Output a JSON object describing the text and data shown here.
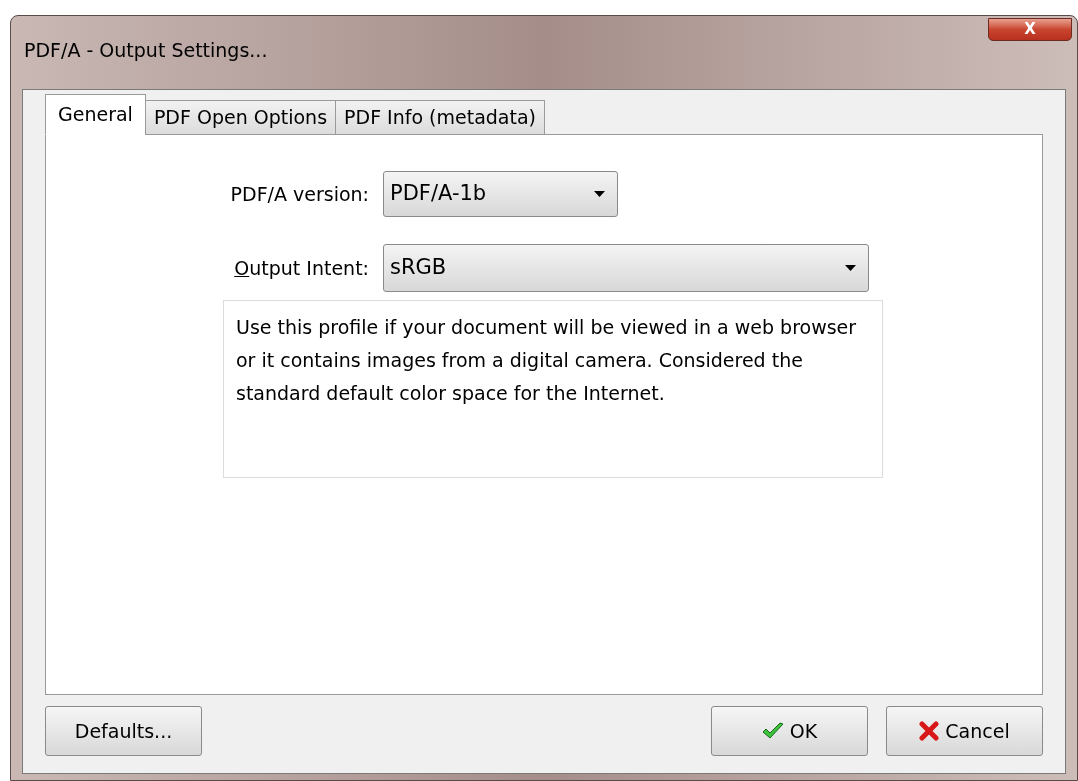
{
  "window": {
    "title": "PDF/A - Output Settings...",
    "close_label": "X"
  },
  "tabs": [
    {
      "label": "General",
      "selected": true
    },
    {
      "label": "PDF Open Options",
      "selected": false
    },
    {
      "label": "PDF Info (metadata)",
      "selected": false
    }
  ],
  "fields": [
    {
      "label": "PDF/A version:",
      "access_key_underlined": false,
      "value": "PDF/A-1b",
      "wide": false
    },
    {
      "label": "Output Intent:",
      "access_key_underlined": true,
      "value": "sRGB",
      "wide": true
    }
  ],
  "description": "Use this profile if your document will be viewed in a web browser or it contains images from a digital camera. Considered the standard default color space for the Internet.",
  "buttons": [
    {
      "kind": "plain",
      "label": "Defaults..."
    },
    {
      "kind": "ok",
      "label": "OK"
    },
    {
      "kind": "cancel",
      "label": "Cancel"
    }
  ]
}
